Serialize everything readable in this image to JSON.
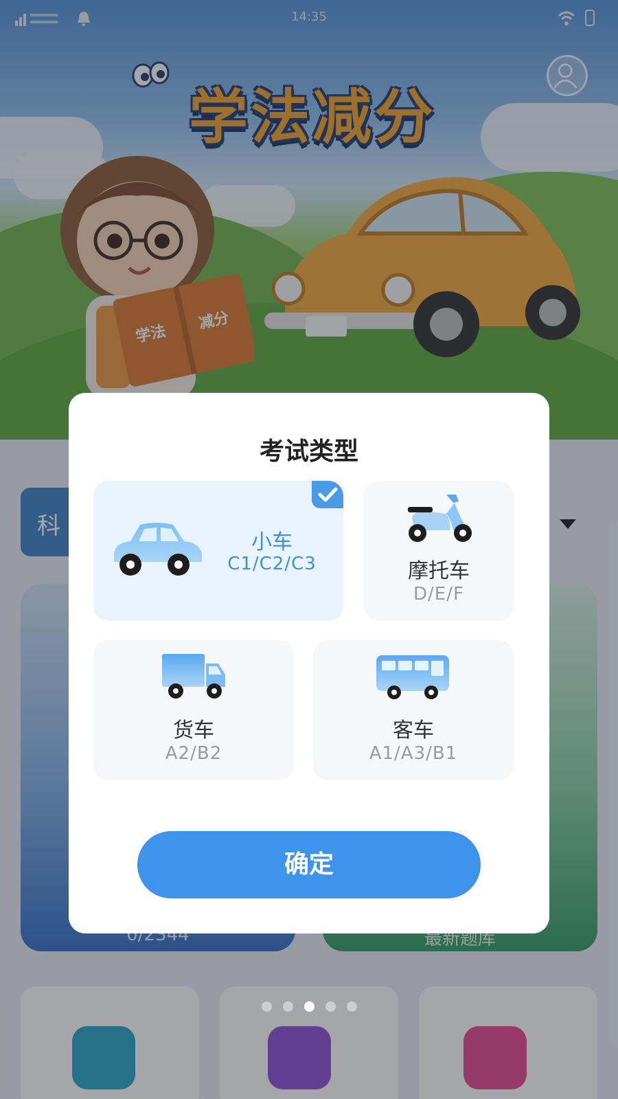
{
  "status_bar": {
    "time": "14:35"
  },
  "app": {
    "title": "学法减分",
    "book_left": "学法",
    "book_right": "减分",
    "subject_tab_label": "科",
    "card_left_caption": "0/2344",
    "card_right_caption": "最新题库"
  },
  "modal": {
    "title": "考试类型",
    "options": [
      {
        "name": "小车",
        "code": "C1/C2/C3",
        "icon": "car-icon",
        "selected": true
      },
      {
        "name": "摩托车",
        "code": "D/E/F",
        "icon": "motorcycle-icon",
        "selected": false
      },
      {
        "name": "货车",
        "code": "A2/B2",
        "icon": "truck-icon",
        "selected": false
      },
      {
        "name": "客车",
        "code": "A1/A3/B1",
        "icon": "bus-icon",
        "selected": false
      }
    ],
    "confirm_label": "确定"
  },
  "pager": {
    "count": 5,
    "active_index": 3
  },
  "colors": {
    "accent": "#3e94ea",
    "selected_bg": "#e9f4ff",
    "selected_text": "#3f8fdc",
    "option_bg": "#f6f7f9",
    "overlay": "rgba(40,44,52,0.42)"
  }
}
